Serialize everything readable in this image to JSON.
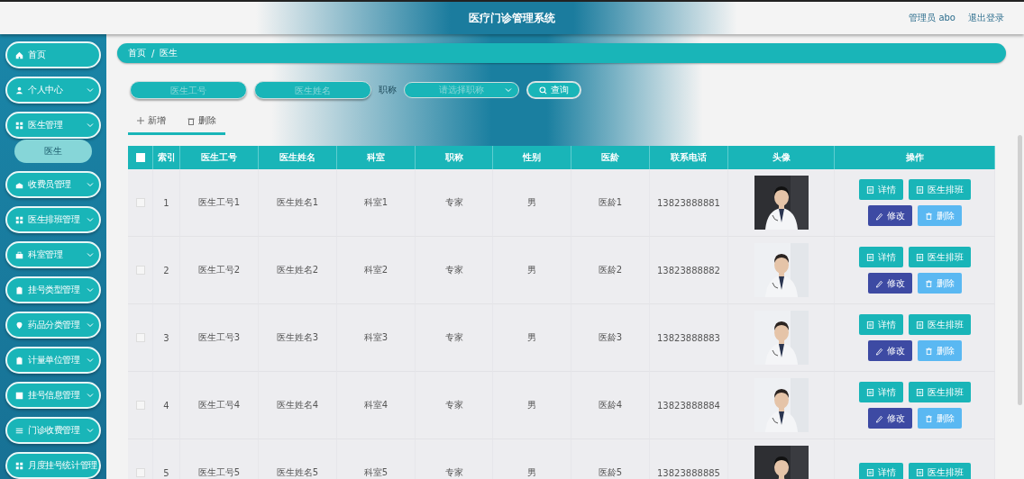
{
  "header": {
    "title": "医疗门诊管理系统",
    "user": "管理员 abo",
    "logout": "退出登录"
  },
  "sidebar": {
    "items": [
      {
        "label": "首页",
        "expandable": false
      },
      {
        "label": "个人中心",
        "expandable": true
      },
      {
        "label": "医生管理",
        "expandable": true,
        "expanded": true,
        "children": [
          {
            "label": "医生",
            "selected": true
          }
        ]
      },
      {
        "label": "收费员管理",
        "expandable": true
      },
      {
        "label": "医生排班管理",
        "expandable": true
      },
      {
        "label": "科室管理",
        "expandable": true
      },
      {
        "label": "挂号类型管理",
        "expandable": true
      },
      {
        "label": "药品分类管理",
        "expandable": true
      },
      {
        "label": "计量单位管理",
        "expandable": true
      },
      {
        "label": "挂号信息管理",
        "expandable": true
      },
      {
        "label": "门诊收费管理",
        "expandable": true
      },
      {
        "label": "月度挂号统计管理"
      }
    ]
  },
  "breadcrumb": {
    "items": [
      "首页",
      "医生"
    ],
    "separator": "/"
  },
  "search": {
    "fields": [
      {
        "placeholder": "医生工号"
      },
      {
        "placeholder": "医生姓名"
      }
    ],
    "select_label": "职称",
    "select_placeholder": "请选择职称",
    "button": "查询"
  },
  "actions": [
    "新增",
    "删除"
  ],
  "table": {
    "select_all_checked": false,
    "columns": [
      "索引",
      "医生工号",
      "医生姓名",
      "科室",
      "职称",
      "性别",
      "医龄",
      "联系电话",
      "头像",
      "操作"
    ],
    "rows": [
      {
        "checked": false,
        "cells": [
          "1",
          "医生工号1",
          "医生姓名1",
          "科室1",
          "专家",
          "男",
          "医龄1",
          "13823888881"
        ],
        "photo": {
          "kind": "picture"
        },
        "buttons": [
          {
            "kind": "detail",
            "label": "详情"
          },
          {
            "kind": "schedule",
            "label": "医生排班"
          },
          {
            "kind": "edit",
            "label": "修改"
          },
          {
            "kind": "delete",
            "label": "删除"
          }
        ]
      },
      {
        "checked": false,
        "cells": [
          "2",
          "医生工号2",
          "医生姓名2",
          "科室2",
          "专家",
          "男",
          "医龄2",
          "13823888882"
        ],
        "photo": {
          "kind": "picture"
        },
        "buttons": [
          {
            "kind": "detail",
            "label": "详情"
          },
          {
            "kind": "schedule",
            "label": "医生排班"
          },
          {
            "kind": "edit",
            "label": "修改"
          },
          {
            "kind": "delete",
            "label": "删除"
          }
        ]
      },
      {
        "checked": false,
        "cells": [
          "3",
          "医生工号3",
          "医生姓名3",
          "科室3",
          "专家",
          "男",
          "医龄3",
          "13823888883"
        ],
        "photo": {
          "kind": "picture"
        },
        "buttons": [
          {
            "kind": "detail",
            "label": "详情"
          },
          {
            "kind": "schedule",
            "label": "医生排班"
          },
          {
            "kind": "edit",
            "label": "修改"
          },
          {
            "kind": "delete",
            "label": "删除"
          }
        ]
      },
      {
        "checked": false,
        "cells": [
          "4",
          "医生工号4",
          "医生姓名4",
          "科室4",
          "专家",
          "男",
          "医龄4",
          "13823888884"
        ],
        "photo": {
          "kind": "picture"
        },
        "buttons": [
          {
            "kind": "detail",
            "label": "详情"
          },
          {
            "kind": "schedule",
            "label": "医生排班"
          },
          {
            "kind": "edit",
            "label": "修改"
          },
          {
            "kind": "delete",
            "label": "删除"
          }
        ]
      },
      {
        "checked": false,
        "cells": [
          "5",
          "医生工号5",
          "医生姓名5",
          "科室5",
          "专家",
          "男",
          "医龄5",
          "13823888885"
        ],
        "photo": {
          "kind": "picture"
        },
        "buttons": [
          {
            "kind": "detail",
            "label": "详情"
          },
          {
            "kind": "schedule",
            "label": "医生排班"
          }
        ]
      }
    ]
  }
}
